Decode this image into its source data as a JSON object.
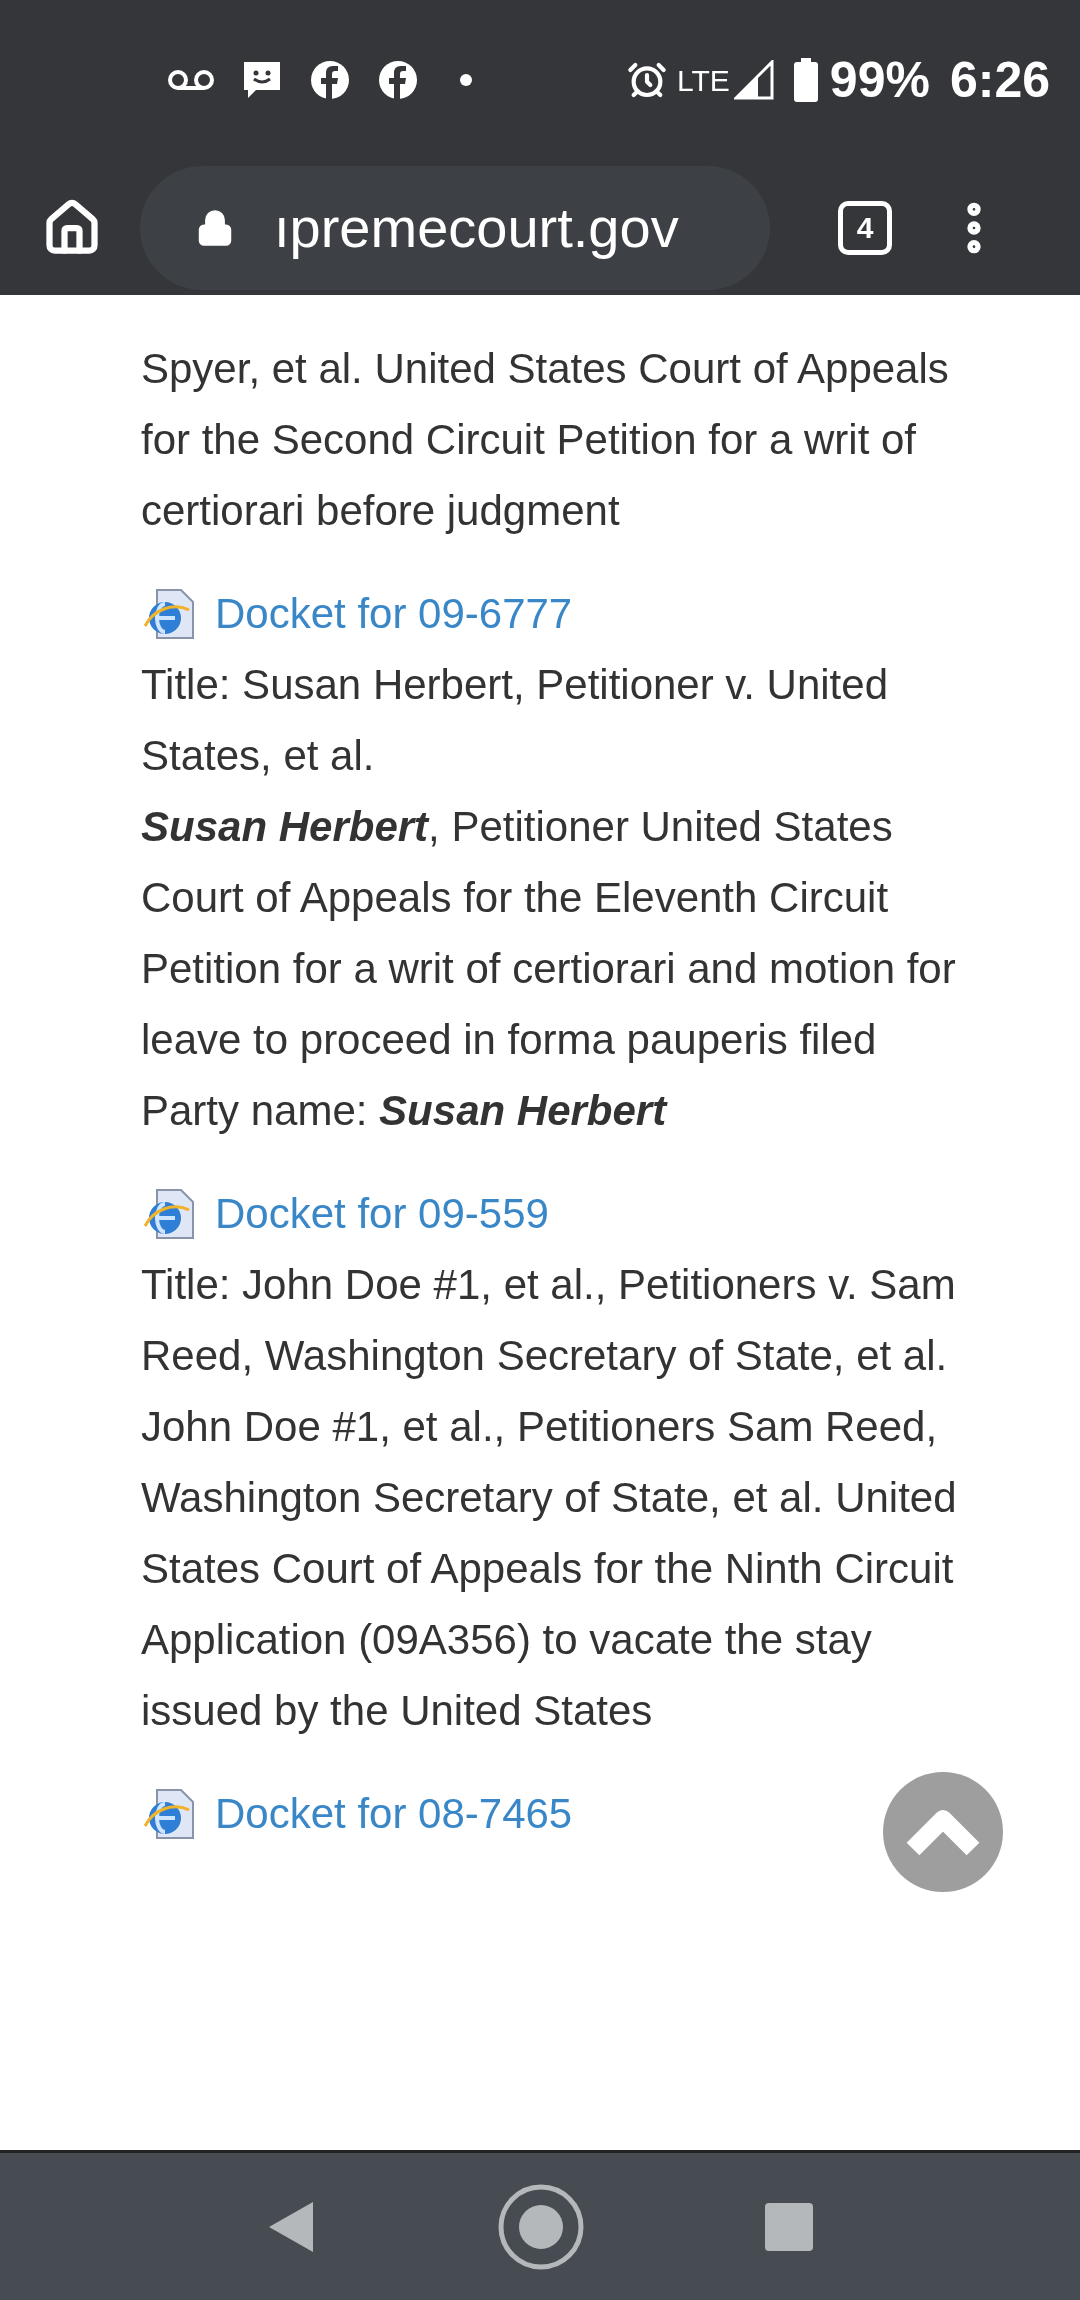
{
  "status_bar": {
    "network": "LTE",
    "battery": "99%",
    "time": "6:26"
  },
  "browser": {
    "url": "ıpremecourt.gov",
    "tab_count": "4"
  },
  "intro_text": "Spyer, et al. United States Court of Appeals for the Second Circuit Petition for a writ of certiorari before judgment",
  "dockets": [
    {
      "link": "Docket for 09-6777",
      "title": "Title: Susan Herbert, Petitioner v. United States, et al.",
      "description": "**Susan Herbert**, Petitioner United States Court of Appeals for the Eleventh Circuit Petition for a writ of certiorari and motion for leave to proceed in forma pauperis filed Party name: **Susan Herbert**"
    },
    {
      "link": "Docket for 09-559",
      "title": "Title: John Doe #1, et al., Petitioners v. Sam Reed, Washington Secretary of State, et al.",
      "description": "John Doe #1, et al., Petitioners Sam Reed, Washington Secretary of State, et al. United States Court of Appeals for the Ninth Circuit Application (09A356) to vacate the stay issued by the United States"
    },
    {
      "link": "Docket for 08-7465"
    }
  ]
}
